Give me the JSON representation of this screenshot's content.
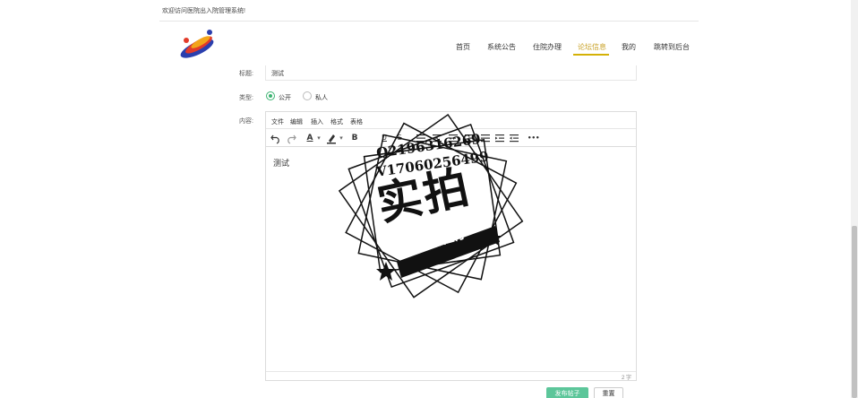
{
  "header": {
    "welcome": "欢迎访问医院出入院管理系统!"
  },
  "nav": {
    "items": [
      "首页",
      "系统公告",
      "住院办理",
      "论坛信息",
      "我的",
      "跳转到后台"
    ],
    "active_index": 3
  },
  "form": {
    "title_label": "标题:",
    "title_value": "测试",
    "type_label": "类型:",
    "type_options": [
      "公开",
      "私人"
    ],
    "type_selected": "公开",
    "content_label": "内容:"
  },
  "editor": {
    "menu": [
      "文件",
      "编辑",
      "插入",
      "格式",
      "表格"
    ],
    "content": "测试",
    "word_count": "2 字",
    "toolbar_icons": [
      "undo-icon",
      "redo-icon",
      "font-color-icon",
      "highlight-icon",
      "bold-icon",
      "underline-icon",
      "strikethrough-icon",
      "list-icon",
      "align-left-icon",
      "align-center-icon",
      "align-right-icon",
      "justify-icon",
      "indent-icon",
      "outdent-icon",
      "more-icon"
    ],
    "toolbar_labels": {
      "font_color": "A",
      "bold": "B",
      "underline": "U",
      "strikethrough": "S",
      "more": "•••"
    }
  },
  "actions": {
    "publish": "发布帖子",
    "reset": "重置"
  },
  "stamp": {
    "line1": "Q2196316269",
    "line2": "V17060256499",
    "big": "实拍",
    "ribbon": "全微程序"
  },
  "colors": {
    "accent": "#d4b106",
    "primary_button": "#5cc69a",
    "radio_checked": "#3cb371"
  }
}
